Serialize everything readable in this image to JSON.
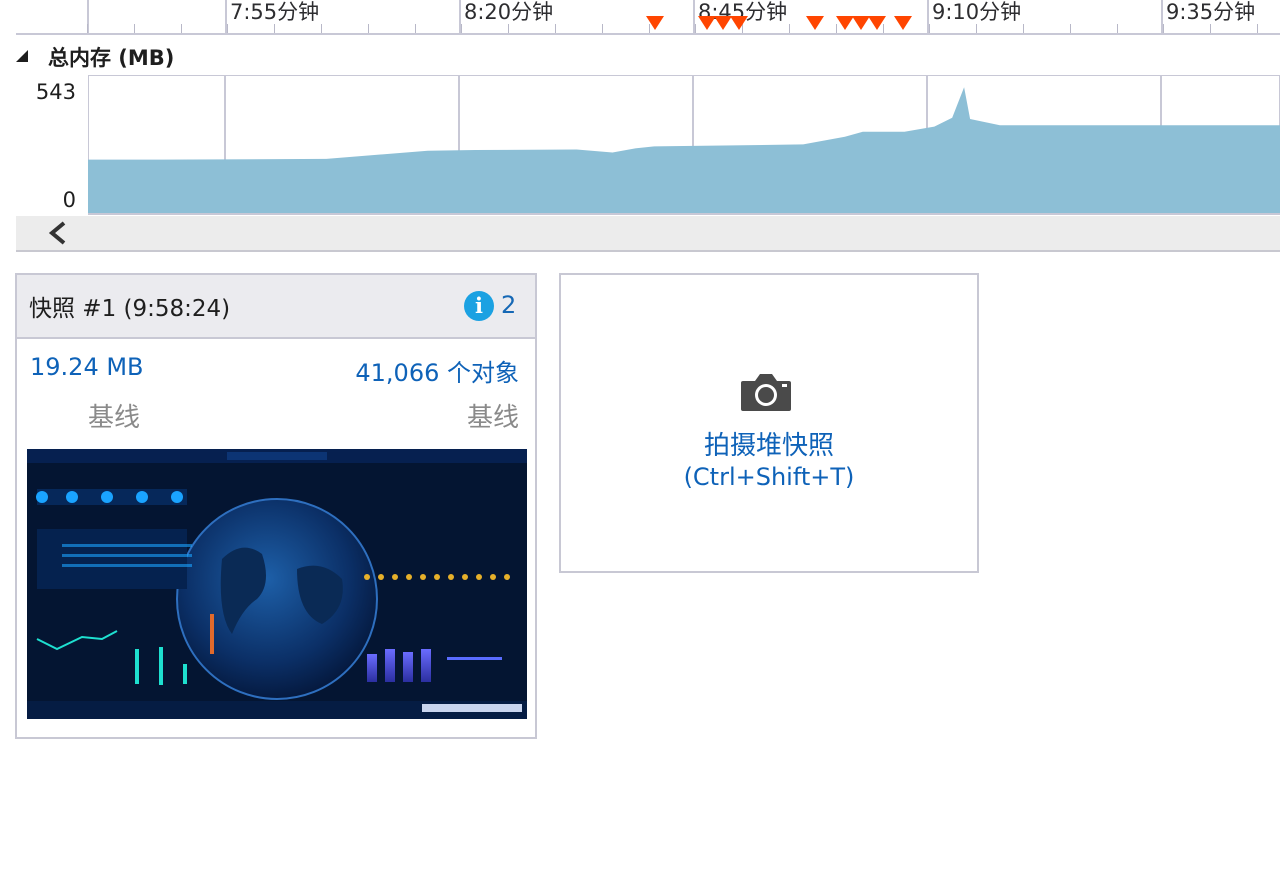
{
  "timeline": {
    "tick_labels": [
      "7:55分钟",
      "8:20分钟",
      "8:45分钟",
      "9:10分钟",
      "9:35分钟"
    ],
    "event_marker_color": "#ff4500"
  },
  "memory": {
    "title": "总内存 (MB)",
    "y_max_label": "543",
    "y_min_label": "0",
    "fill_color": "#8dbfd6"
  },
  "chart_data": {
    "type": "area",
    "title": "总内存 (MB)",
    "xlabel": "",
    "ylabel": "",
    "ylim": [
      0,
      543
    ],
    "x_tick_labels": [
      "7:55分钟",
      "8:20分钟",
      "8:45分钟",
      "9:10分钟",
      "9:35分钟"
    ],
    "x": [
      7.8,
      7.92,
      8.2,
      8.37,
      8.45,
      8.62,
      8.68,
      8.72,
      8.75,
      9.0,
      9.07,
      9.1,
      9.17,
      9.22,
      9.25,
      9.27,
      9.28,
      9.3,
      9.33,
      9.35,
      9.4,
      9.8
    ],
    "values": [
      210,
      210,
      213,
      245,
      248,
      250,
      238,
      255,
      262,
      270,
      300,
      320,
      320,
      340,
      375,
      495,
      370,
      360,
      345,
      345,
      345,
      345
    ]
  },
  "snapshot": {
    "title": "快照 #1  (9:58:24)",
    "info_count": "2",
    "size": "19.24 MB",
    "objects": "41,066 个对象",
    "size_baseline": "基线",
    "objects_baseline": "基线"
  },
  "take_snapshot": {
    "label": "拍摄堆快照",
    "shortcut": "(Ctrl+Shift+T)"
  }
}
